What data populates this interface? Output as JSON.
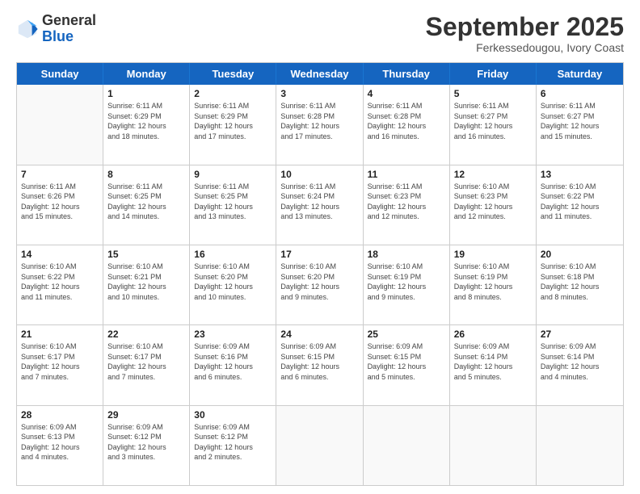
{
  "logo": {
    "general": "General",
    "blue": "Blue"
  },
  "title": "September 2025",
  "location": "Ferkessedougou, Ivory Coast",
  "days": [
    "Sunday",
    "Monday",
    "Tuesday",
    "Wednesday",
    "Thursday",
    "Friday",
    "Saturday"
  ],
  "weeks": [
    [
      {
        "day": "",
        "info": ""
      },
      {
        "day": "1",
        "info": "Sunrise: 6:11 AM\nSunset: 6:29 PM\nDaylight: 12 hours\nand 18 minutes."
      },
      {
        "day": "2",
        "info": "Sunrise: 6:11 AM\nSunset: 6:29 PM\nDaylight: 12 hours\nand 17 minutes."
      },
      {
        "day": "3",
        "info": "Sunrise: 6:11 AM\nSunset: 6:28 PM\nDaylight: 12 hours\nand 17 minutes."
      },
      {
        "day": "4",
        "info": "Sunrise: 6:11 AM\nSunset: 6:28 PM\nDaylight: 12 hours\nand 16 minutes."
      },
      {
        "day": "5",
        "info": "Sunrise: 6:11 AM\nSunset: 6:27 PM\nDaylight: 12 hours\nand 16 minutes."
      },
      {
        "day": "6",
        "info": "Sunrise: 6:11 AM\nSunset: 6:27 PM\nDaylight: 12 hours\nand 15 minutes."
      }
    ],
    [
      {
        "day": "7",
        "info": "Sunrise: 6:11 AM\nSunset: 6:26 PM\nDaylight: 12 hours\nand 15 minutes."
      },
      {
        "day": "8",
        "info": "Sunrise: 6:11 AM\nSunset: 6:25 PM\nDaylight: 12 hours\nand 14 minutes."
      },
      {
        "day": "9",
        "info": "Sunrise: 6:11 AM\nSunset: 6:25 PM\nDaylight: 12 hours\nand 13 minutes."
      },
      {
        "day": "10",
        "info": "Sunrise: 6:11 AM\nSunset: 6:24 PM\nDaylight: 12 hours\nand 13 minutes."
      },
      {
        "day": "11",
        "info": "Sunrise: 6:11 AM\nSunset: 6:23 PM\nDaylight: 12 hours\nand 12 minutes."
      },
      {
        "day": "12",
        "info": "Sunrise: 6:10 AM\nSunset: 6:23 PM\nDaylight: 12 hours\nand 12 minutes."
      },
      {
        "day": "13",
        "info": "Sunrise: 6:10 AM\nSunset: 6:22 PM\nDaylight: 12 hours\nand 11 minutes."
      }
    ],
    [
      {
        "day": "14",
        "info": "Sunrise: 6:10 AM\nSunset: 6:22 PM\nDaylight: 12 hours\nand 11 minutes."
      },
      {
        "day": "15",
        "info": "Sunrise: 6:10 AM\nSunset: 6:21 PM\nDaylight: 12 hours\nand 10 minutes."
      },
      {
        "day": "16",
        "info": "Sunrise: 6:10 AM\nSunset: 6:20 PM\nDaylight: 12 hours\nand 10 minutes."
      },
      {
        "day": "17",
        "info": "Sunrise: 6:10 AM\nSunset: 6:20 PM\nDaylight: 12 hours\nand 9 minutes."
      },
      {
        "day": "18",
        "info": "Sunrise: 6:10 AM\nSunset: 6:19 PM\nDaylight: 12 hours\nand 9 minutes."
      },
      {
        "day": "19",
        "info": "Sunrise: 6:10 AM\nSunset: 6:19 PM\nDaylight: 12 hours\nand 8 minutes."
      },
      {
        "day": "20",
        "info": "Sunrise: 6:10 AM\nSunset: 6:18 PM\nDaylight: 12 hours\nand 8 minutes."
      }
    ],
    [
      {
        "day": "21",
        "info": "Sunrise: 6:10 AM\nSunset: 6:17 PM\nDaylight: 12 hours\nand 7 minutes."
      },
      {
        "day": "22",
        "info": "Sunrise: 6:10 AM\nSunset: 6:17 PM\nDaylight: 12 hours\nand 7 minutes."
      },
      {
        "day": "23",
        "info": "Sunrise: 6:09 AM\nSunset: 6:16 PM\nDaylight: 12 hours\nand 6 minutes."
      },
      {
        "day": "24",
        "info": "Sunrise: 6:09 AM\nSunset: 6:15 PM\nDaylight: 12 hours\nand 6 minutes."
      },
      {
        "day": "25",
        "info": "Sunrise: 6:09 AM\nSunset: 6:15 PM\nDaylight: 12 hours\nand 5 minutes."
      },
      {
        "day": "26",
        "info": "Sunrise: 6:09 AM\nSunset: 6:14 PM\nDaylight: 12 hours\nand 5 minutes."
      },
      {
        "day": "27",
        "info": "Sunrise: 6:09 AM\nSunset: 6:14 PM\nDaylight: 12 hours\nand 4 minutes."
      }
    ],
    [
      {
        "day": "28",
        "info": "Sunrise: 6:09 AM\nSunset: 6:13 PM\nDaylight: 12 hours\nand 4 minutes."
      },
      {
        "day": "29",
        "info": "Sunrise: 6:09 AM\nSunset: 6:12 PM\nDaylight: 12 hours\nand 3 minutes."
      },
      {
        "day": "30",
        "info": "Sunrise: 6:09 AM\nSunset: 6:12 PM\nDaylight: 12 hours\nand 2 minutes."
      },
      {
        "day": "",
        "info": ""
      },
      {
        "day": "",
        "info": ""
      },
      {
        "day": "",
        "info": ""
      },
      {
        "day": "",
        "info": ""
      }
    ]
  ]
}
